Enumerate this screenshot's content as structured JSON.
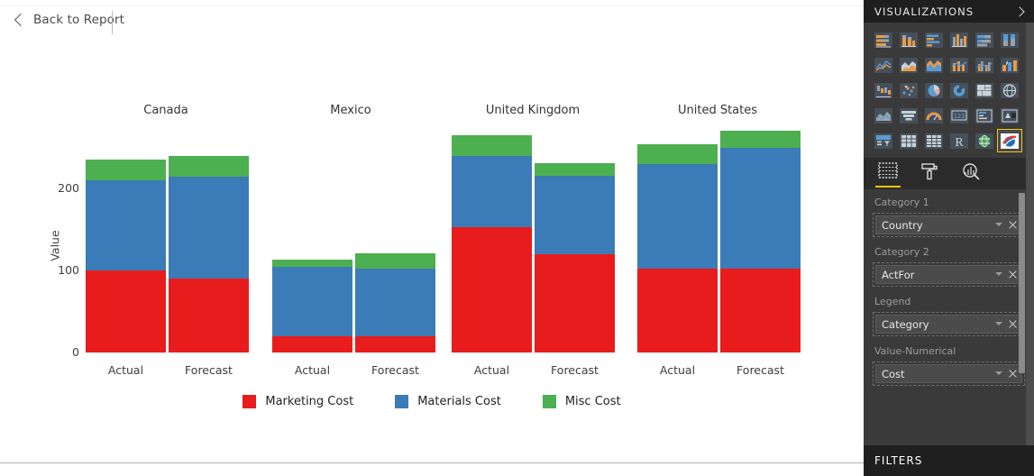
{
  "topbar": {
    "back_label": "Back to Report",
    "back_icon": "chevron-left-icon"
  },
  "chart_data": {
    "type": "bar",
    "subtype": "stacked-column-small-multiples",
    "title": "",
    "xlabel": "",
    "ylabel": "Value",
    "ylim": [
      0,
      260
    ],
    "yticks": [
      "0",
      "100",
      "200"
    ],
    "ytick_values": [
      0,
      100,
      200
    ],
    "grid": false,
    "legend_position": "bottom",
    "panels": [
      "Canada",
      "Mexico",
      "United Kingdom",
      "United States"
    ],
    "categories": [
      "Actual",
      "Forecast"
    ],
    "series": [
      {
        "name": "Marketing Cost",
        "color": "#E81C1C"
      },
      {
        "name": "Materials Cost",
        "color": "#3B7BB8"
      },
      {
        "name": "Misc Cost",
        "color": "#4CAF50"
      }
    ],
    "data": [
      {
        "panel": "Canada",
        "bars": [
          {
            "category": "Actual",
            "marketing": 100,
            "materials": 110,
            "misc": 25,
            "total": 235
          },
          {
            "category": "Forecast",
            "marketing": 90,
            "materials": 124,
            "misc": 26,
            "total": 240
          }
        ]
      },
      {
        "panel": "Mexico",
        "bars": [
          {
            "category": "Actual",
            "marketing": 20,
            "materials": 84,
            "misc": 9,
            "total": 113
          },
          {
            "category": "Forecast",
            "marketing": 20,
            "materials": 82,
            "misc": 19,
            "total": 121
          }
        ]
      },
      {
        "panel": "United Kingdom",
        "bars": [
          {
            "category": "Actual",
            "marketing": 153,
            "materials": 87,
            "misc": 25,
            "total": 265
          },
          {
            "category": "Forecast",
            "marketing": 120,
            "materials": 95,
            "misc": 16,
            "total": 231
          }
        ]
      },
      {
        "panel": "United States",
        "bars": [
          {
            "category": "Actual",
            "marketing": 102,
            "materials": 128,
            "misc": 24,
            "total": 254
          },
          {
            "category": "Forecast",
            "marketing": 102,
            "materials": 148,
            "misc": 20,
            "total": 270
          }
        ]
      }
    ],
    "legend": [
      {
        "label": "Marketing Cost",
        "color": "#E81C1C"
      },
      {
        "label": "Materials Cost",
        "color": "#3B7BB8"
      },
      {
        "label": "Misc Cost",
        "color": "#4CAF50"
      }
    ]
  },
  "panel": {
    "header_title": "VISUALIZATIONS",
    "header_icon": "chevron-right-icon",
    "more_visuals": "...",
    "icons": [
      "stacked-bar-chart-icon",
      "stacked-column-chart-icon",
      "clustered-bar-chart-icon",
      "clustered-column-chart-icon",
      "100-percent-stacked-bar-chart-icon",
      "100-percent-stacked-column-chart-icon",
      "line-chart-icon",
      "area-chart-icon",
      "stacked-area-chart-icon",
      "line-and-stacked-column-chart-icon",
      "line-and-clustered-column-chart-icon",
      "ribbon-chart-icon",
      "waterfall-chart-icon",
      "scatter-chart-icon",
      "pie-chart-icon",
      "donut-chart-icon",
      "treemap-icon",
      "map-icon",
      "filled-map-icon",
      "funnel-chart-icon",
      "gauge-chart-icon",
      "card-icon",
      "multi-row-card-icon",
      "kpi-icon",
      "slicer-icon",
      "table-icon",
      "matrix-icon",
      "r-script-visual-icon",
      "arcgis-map-icon",
      "custom-visual-icon"
    ],
    "selected_icon": "custom-visual-icon",
    "well_tabs": [
      {
        "name": "fields-tab",
        "icon": "fields-grid-icon",
        "active": true
      },
      {
        "name": "format-tab",
        "icon": "paint-roller-icon",
        "active": false
      },
      {
        "name": "analytics-tab",
        "icon": "magnifier-chart-icon",
        "active": false
      }
    ],
    "wells": [
      {
        "label": "Category 1",
        "field": "Country",
        "caret_icon": "chevron-down-icon",
        "remove_icon": "close-icon"
      },
      {
        "label": "Category 2",
        "field": "ActFor",
        "caret_icon": "chevron-down-icon",
        "remove_icon": "close-icon"
      },
      {
        "label": "Legend",
        "field": "Category",
        "caret_icon": "chevron-down-icon",
        "remove_icon": "close-icon"
      },
      {
        "label": "Value-Numerical",
        "field": "Cost",
        "caret_icon": "chevron-down-icon",
        "remove_icon": "close-icon"
      }
    ],
    "filters_title": "FILTERS"
  }
}
